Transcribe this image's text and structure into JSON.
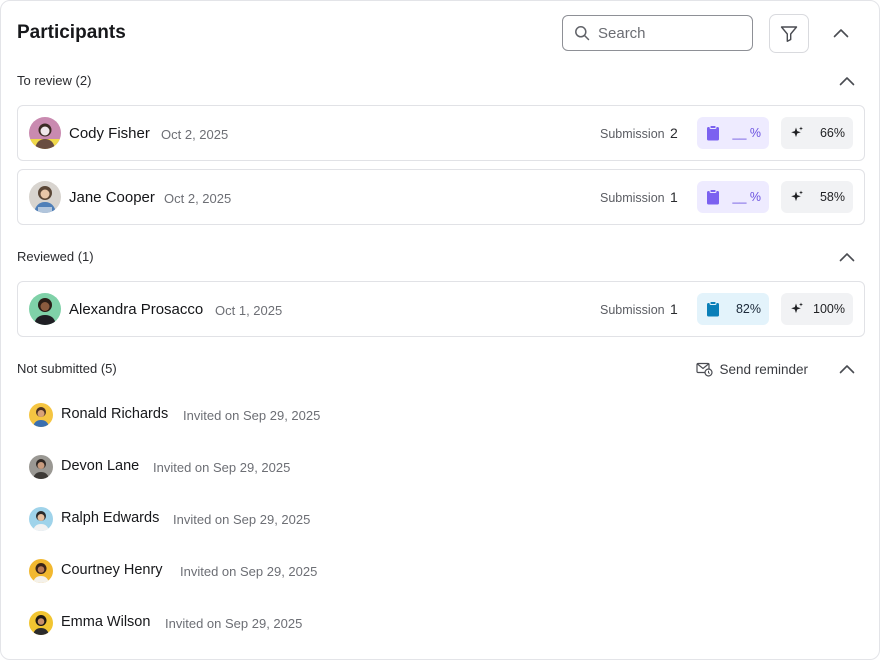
{
  "header": {
    "title": "Participants",
    "search_placeholder": "Search",
    "filter_icon": "filter-icon",
    "collapse_icon": "chevron-up-icon"
  },
  "sections": {
    "to_review": {
      "label": "To review (2)",
      "items": [
        {
          "name": "Cody Fisher",
          "date": "Oct 2, 2025",
          "submission_label": "Submission",
          "submission": "2",
          "review_score": "__ %",
          "ai_score": "66%"
        },
        {
          "name": "Jane Cooper",
          "date": "Oct 2, 2025",
          "submission_label": "Submission",
          "submission": "1",
          "review_score": "__ %",
          "ai_score": "58%"
        }
      ]
    },
    "reviewed": {
      "label": "Reviewed (1)",
      "items": [
        {
          "name": "Alexandra Prosacco",
          "date": "Oct 1, 2025",
          "submission_label": "Submission",
          "submission": "1",
          "review_score": "82%",
          "ai_score": "100%"
        }
      ]
    },
    "not_submitted": {
      "label": "Not submitted (5)",
      "reminder_label": "Send reminder",
      "items": [
        {
          "name": "Ronald Richards",
          "invited": "Invited on Sep 29, 2025"
        },
        {
          "name": "Devon Lane",
          "invited": "Invited on Sep 29, 2025"
        },
        {
          "name": "Ralph Edwards",
          "invited": "Invited on Sep 29, 2025"
        },
        {
          "name": "Courtney Henry",
          "invited": "Invited on Sep 29, 2025"
        },
        {
          "name": "Emma Wilson",
          "invited": "Invited on Sep 29, 2025"
        }
      ]
    }
  },
  "colors": {
    "review_pill_bg": "#eeebff",
    "review_accent": "#7b61f0",
    "reviewed_pill_bg": "#e3f3fb",
    "reviewed_accent": "#0a7fb8",
    "ai_pill_bg": "#f1f2f4"
  }
}
